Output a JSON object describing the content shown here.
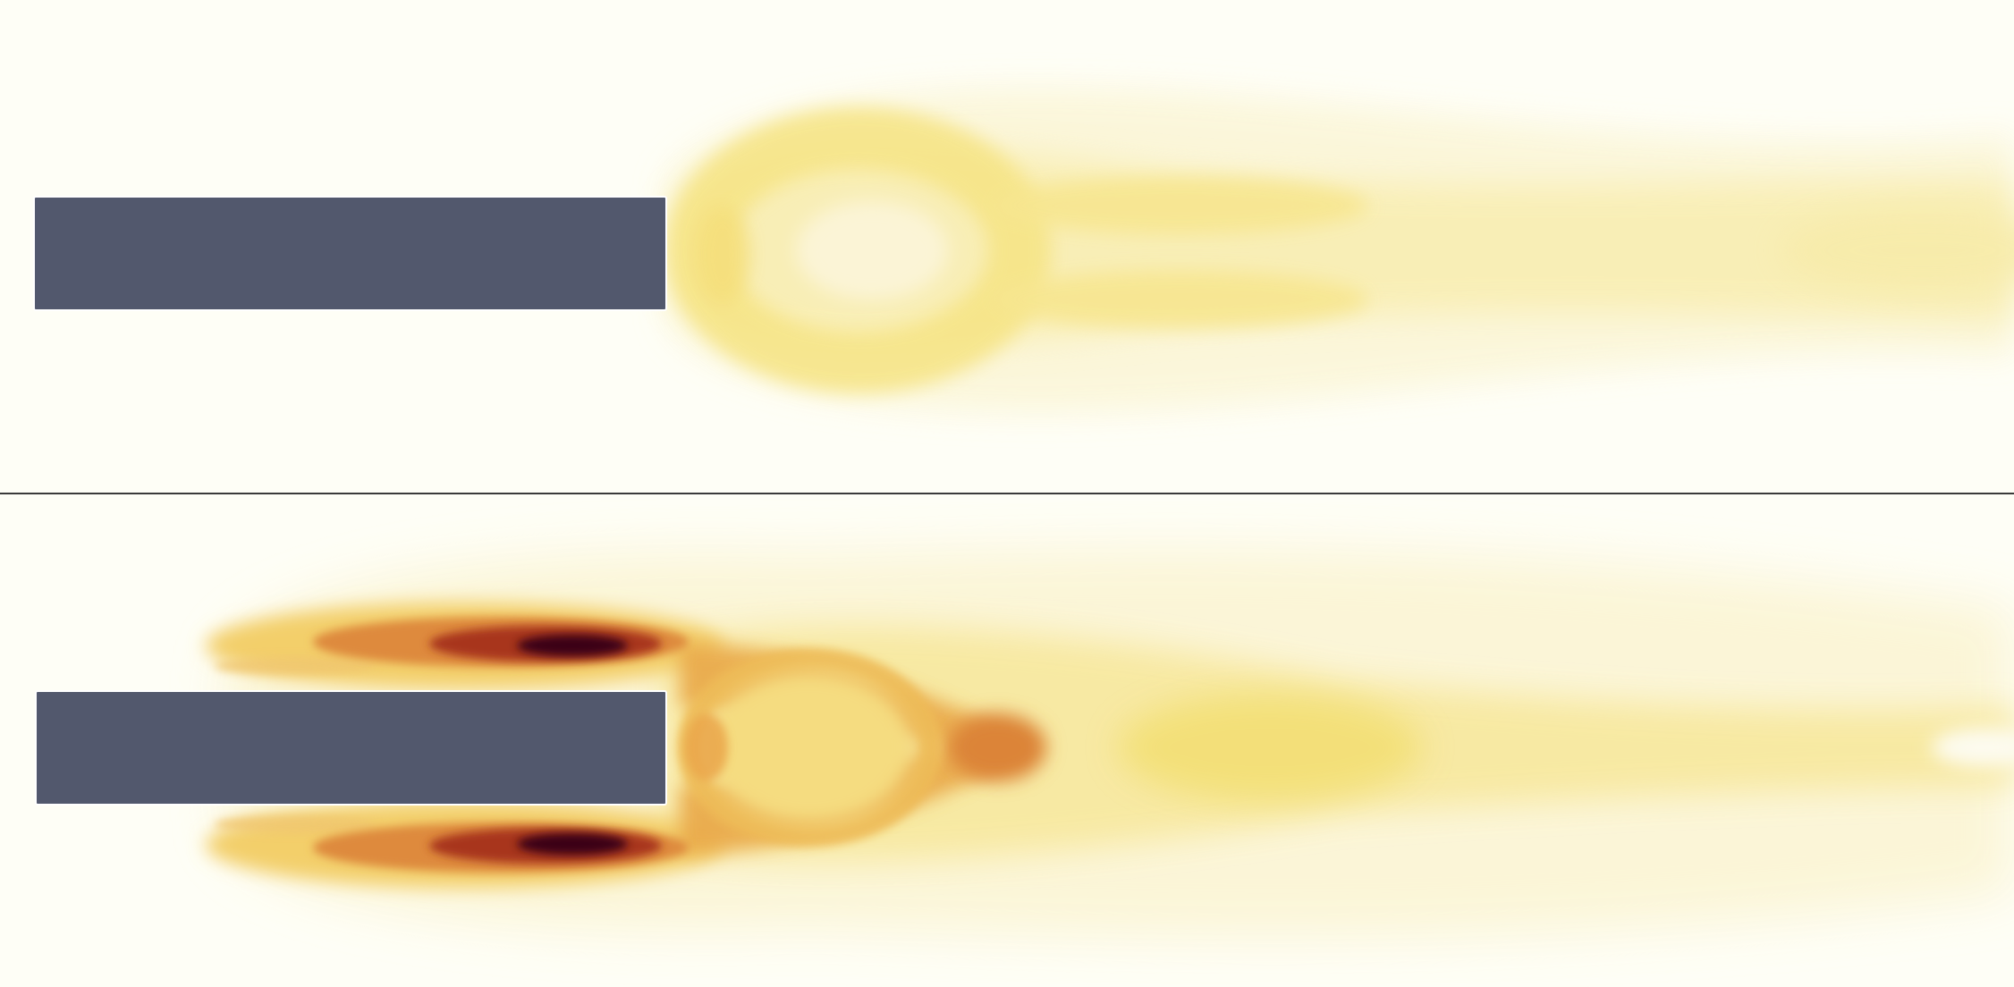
{
  "colors": {
    "background": "#fefef6",
    "obstacle": "#52586d",
    "divider": "#3a3a3a",
    "colormap": [
      "#fefef6",
      "#fbf3c4",
      "#f6e17a",
      "#eeb24a",
      "#d8742a",
      "#a3331a",
      "#5a0a14",
      "#2b0010"
    ]
  },
  "panels": [
    {
      "name": "top-panel",
      "label": "",
      "intensity": "low"
    },
    {
      "name": "bottom-panel",
      "label": "",
      "intensity": "high"
    }
  ]
}
